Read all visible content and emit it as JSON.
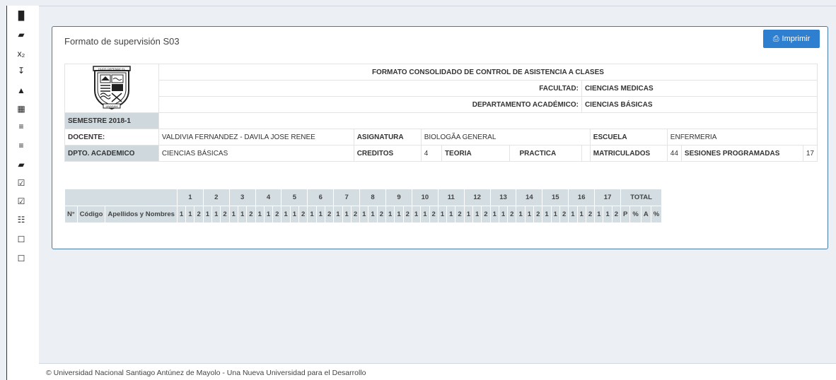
{
  "sidebar": {
    "icons": [
      "bar-chart-icon",
      "book-icon",
      "subscript-icon",
      "sort-numeric-icon",
      "lock-icon",
      "calendar-icon",
      "list-icon",
      "list-icon",
      "book-icon",
      "checkbox-icon",
      "checkbox-icon",
      "table-icon",
      "file-icon",
      "file-icon"
    ],
    "glyphs": [
      "▐▌",
      "▰",
      "x₂",
      "↧",
      "▲",
      "▦",
      "≡",
      "≡",
      "▰",
      "☑",
      "☑",
      "☷",
      "☐",
      "☐"
    ]
  },
  "panel": {
    "title": "Formato de supervisión S03",
    "print_icon": "⎙",
    "print_label": "Imprimir"
  },
  "logo": {
    "top_text": "HIJOS DEPENDE EL",
    "bottom_text": "UNASAM"
  },
  "header": {
    "format_title": "FORMATO CONSOLIDADO DE CONTROL DE ASISTENCIA A CLASES",
    "facultad_label": "FACULTAD:",
    "facultad_value": "CIENCIAS MEDICAS",
    "depto_label": "DEPARTAMENTO ACADÉMICO:",
    "depto_value": "CIENCIAS BÁSICAS",
    "semestre": "SEMESTRE 2018-1",
    "docente_label": "DOCENTE:",
    "docente_value": "VALDIVIA FERNANDEZ - DAVILA JOSE RENEE",
    "asignatura_label": "ASIGNATURA",
    "asignatura_value": "BIOLOGÃA GENERAL",
    "escuela_label": "ESCUELA",
    "escuela_value": "ENFERMERIA",
    "dpto_label": "DPTO. ACADEMICO",
    "dpto_value": "CIENCIAS BÁSICAS",
    "creditos_label": "CREDITOS",
    "creditos_value": "4",
    "teoria_label": "TEORIA",
    "teoria_value": "",
    "practica_label": "PRACTICA",
    "practica_value": "",
    "matriculados_label": "MATRICULADOS",
    "matriculados_value": "44",
    "sesiones_label": "SESIONES PROGRAMADAS",
    "sesiones_value": "17"
  },
  "attendance": {
    "col_n": "N°",
    "col_codigo": "Código",
    "col_nombres": "Apellidos y Nombres",
    "weeks": [
      "1",
      "2",
      "3",
      "4",
      "5",
      "6",
      "7",
      "8",
      "9",
      "10",
      "11",
      "12",
      "13",
      "14",
      "15",
      "16",
      "17"
    ],
    "sub_cols": [
      "1",
      "1",
      "2"
    ],
    "total_label": "TOTAL",
    "total_cols": [
      "P",
      "%",
      "A",
      "%"
    ]
  },
  "footer": {
    "text": "© Universidad Nacional Santiago Antúnez de Mayolo - Una Nueva Universidad para el Desarrollo"
  }
}
